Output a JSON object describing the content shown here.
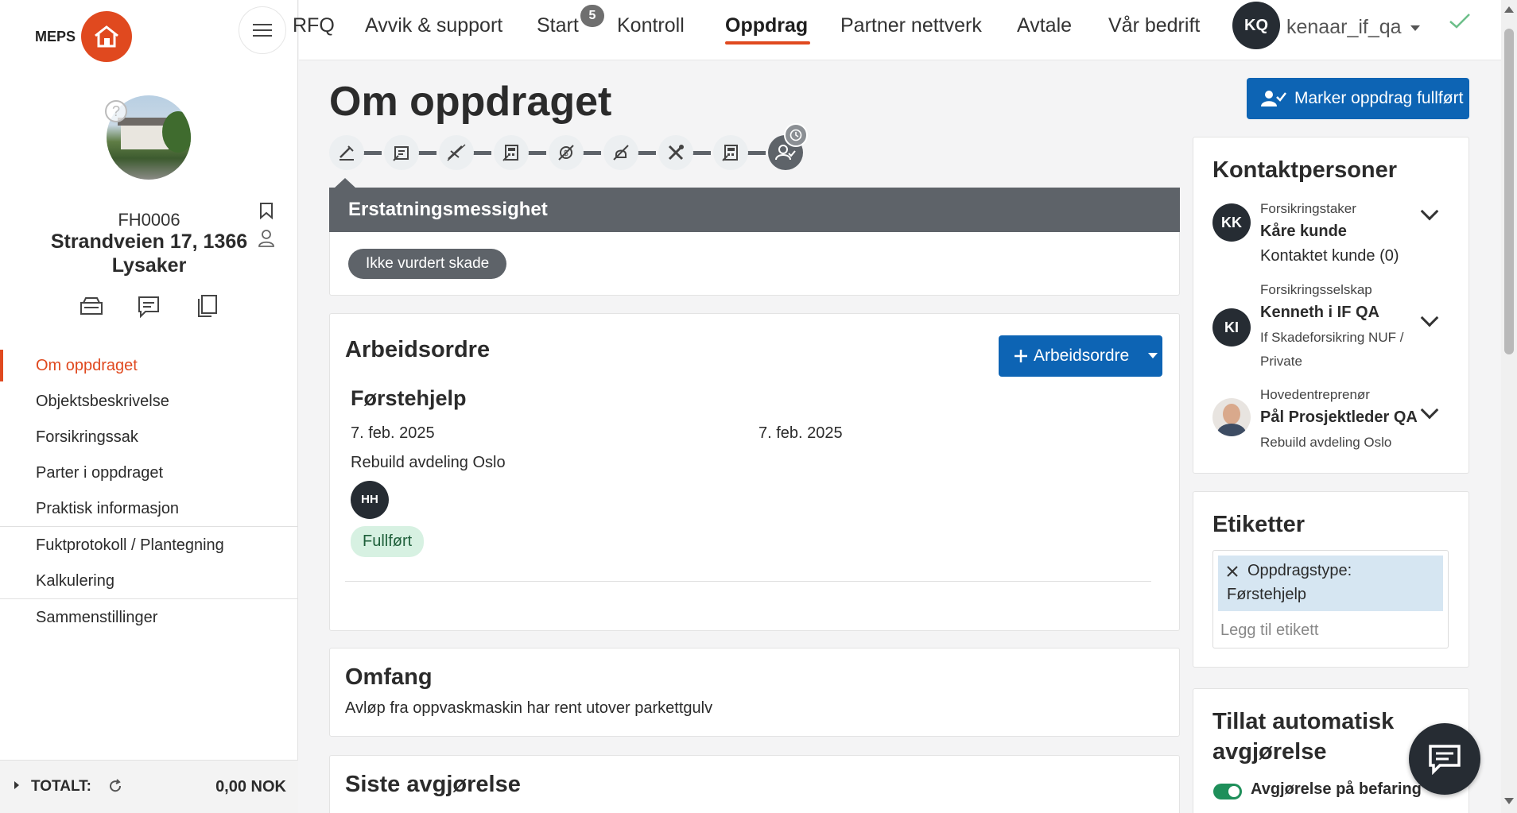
{
  "sidebar": {
    "logo_text": "MEPS",
    "object_id": "FH0006",
    "address_line1": "Strandveien 17, 1366",
    "address_line2": "Lysaker",
    "menu": [
      {
        "label": "Om oppdraget",
        "active": true
      },
      {
        "label": "Objektsbeskrivelse"
      },
      {
        "label": "Forsikringssak"
      },
      {
        "label": "Parter i oppdraget"
      },
      {
        "label": "Praktisk informasjon"
      },
      {
        "label": "Fuktprotokoll / Plantegning"
      },
      {
        "label": "Kalkulering"
      },
      {
        "label": "Sammenstillinger"
      }
    ],
    "footer": {
      "label": "TOTALT:",
      "amount": "0,00 NOK"
    }
  },
  "topnav": {
    "items": [
      "RFQ",
      "Avvik & support",
      "Start",
      "Kontroll",
      "Oppdrag",
      "Partner nettverk",
      "Avtale",
      "Vår bedrift"
    ],
    "active": "Oppdrag",
    "start_badge": "5",
    "user_initials": "KQ",
    "username": "kenaar_if_qa"
  },
  "main": {
    "title": "Om oppdraget",
    "mark_complete_button": "Marker oppdrag fullført",
    "erstatning": {
      "header": "Erstatningsmessighet",
      "status_pill": "Ikke vurdert skade"
    },
    "arbeidsordre": {
      "title": "Arbeidsordre",
      "add_button": "Arbeidsordre",
      "item": {
        "title": "Førstehjelp",
        "date_start": "7. feb. 2025",
        "date_end": "7. feb. 2025",
        "company": "Rebuild avdeling Oslo",
        "assignee_initials": "HH",
        "status": "Fullført"
      }
    },
    "omfang": {
      "title": "Omfang",
      "text": "Avløp fra oppvaskmaskin har rent utover parkettgulv"
    },
    "siste_avgjorelse": {
      "title": "Siste avgjørelse"
    }
  },
  "right": {
    "kontakt": {
      "title": "Kontaktpersoner",
      "persons": [
        {
          "initials": "KK",
          "role": "Forsikringstaker",
          "name": "Kåre kunde",
          "detail": "Kontaktet kunde (0)"
        },
        {
          "initials": "KI",
          "role": "Forsikringsselskap",
          "name": "Kenneth i IF QA",
          "detail1": "If Skadeforsikring NUF /",
          "detail2": "Private"
        },
        {
          "initials": "",
          "role": "Hovedentreprenør",
          "name": "Pål Prosjektleder QA",
          "detail": "Rebuild avdeling Oslo"
        }
      ]
    },
    "etiketter": {
      "title": "Etiketter",
      "tag_line1": "Oppdragstype:",
      "tag_line2": "Førstehjelp",
      "placeholder": "Legg til etikett"
    },
    "auto": {
      "title_line1": "Tillat automatisk",
      "title_line2": "avgjørelse",
      "toggle_label": "Avgjørelse på befaring",
      "toggle_on": true
    }
  },
  "colors": {
    "accent": "#e0491f",
    "primary": "#0d64b4",
    "dark": "#262c33",
    "step": "#5e6369"
  }
}
